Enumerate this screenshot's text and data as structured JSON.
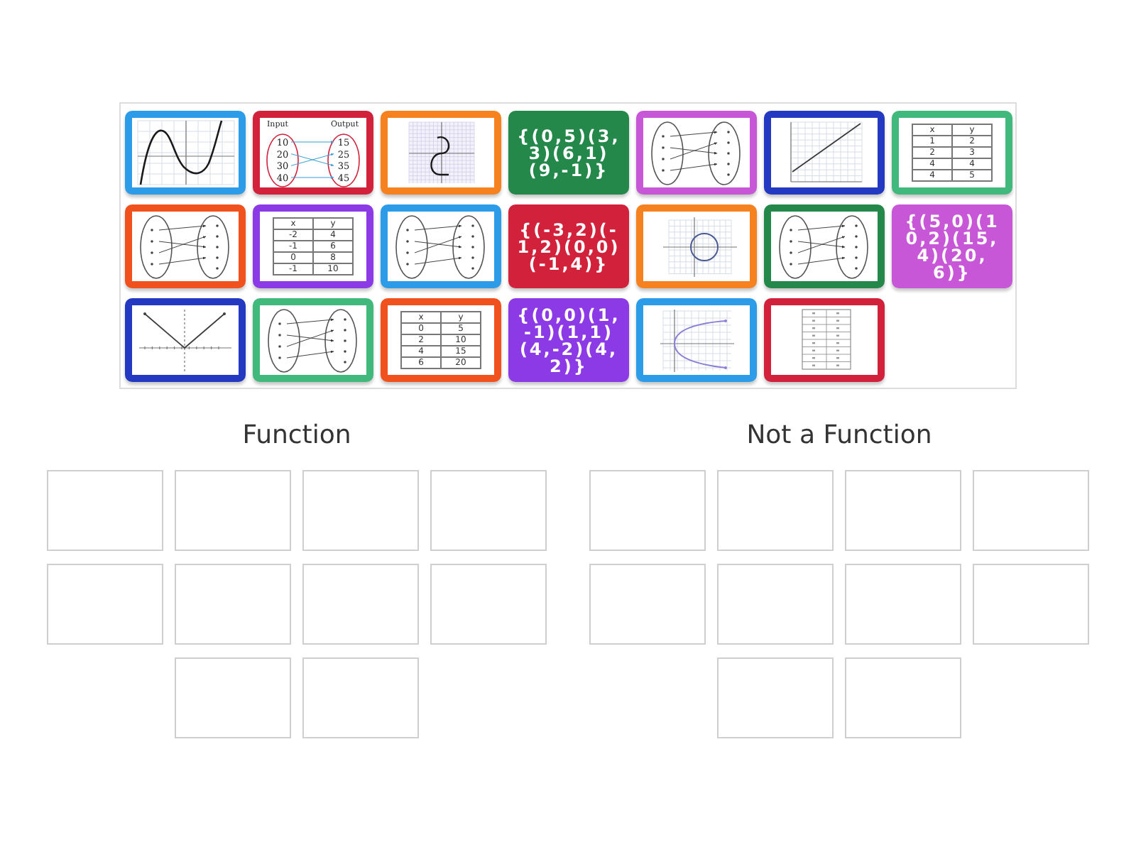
{
  "tiles": [
    {
      "kind": "cubic",
      "color": "#2c9be8"
    },
    {
      "kind": "mapping",
      "color": "#d2213a",
      "input_label": "Input",
      "output_label": "Output",
      "inputs": [
        "10",
        "20",
        "30",
        "40"
      ],
      "outputs": [
        "15",
        "25",
        "35",
        "45"
      ]
    },
    {
      "kind": "scurve",
      "color": "#f5821f"
    },
    {
      "kind": "pairs",
      "color": "#23884a",
      "text": "{(0,5)(3,3)(6,1)(9,-1)}"
    },
    {
      "kind": "mapping",
      "color": "#c757d6"
    },
    {
      "kind": "line",
      "color": "#2439c2"
    },
    {
      "kind": "table",
      "color": "#41b97d",
      "rows": [
        [
          "x",
          "y"
        ],
        [
          "1",
          "2"
        ],
        [
          "2",
          "3"
        ],
        [
          "4",
          "4"
        ],
        [
          "4",
          "5"
        ]
      ]
    },
    {
      "kind": "mapping",
      "color": "#f0511d"
    },
    {
      "kind": "table",
      "color": "#8b3ae6",
      "rows": [
        [
          "x",
          "y"
        ],
        [
          "-2",
          "4"
        ],
        [
          "-1",
          "6"
        ],
        [
          "0",
          "8"
        ],
        [
          "-1",
          "10"
        ]
      ]
    },
    {
      "kind": "mapping",
      "color": "#2c9be8"
    },
    {
      "kind": "pairs",
      "color": "#d2213a",
      "text": "{(-3,2)(-1,2)(0,0)(-1,4)}"
    },
    {
      "kind": "circle",
      "color": "#f5821f"
    },
    {
      "kind": "mapping",
      "color": "#23884a"
    },
    {
      "kind": "pairs",
      "color": "#c757d6",
      "text": "{(5,0)(10,2)(15,4)(20,6)}"
    },
    {
      "kind": "vshape",
      "color": "#2439c2"
    },
    {
      "kind": "mapping",
      "color": "#41b97d"
    },
    {
      "kind": "table",
      "color": "#f0511d",
      "rows": [
        [
          "x",
          "y"
        ],
        [
          "0",
          "5"
        ],
        [
          "2",
          "10"
        ],
        [
          "4",
          "15"
        ],
        [
          "6",
          "20"
        ]
      ]
    },
    {
      "kind": "pairs",
      "color": "#8b3ae6",
      "text": "{(0,0)(1,-1)(1,1)(4,-2)(4,2)}"
    },
    {
      "kind": "parabola",
      "color": "#2c9be8"
    },
    {
      "kind": "table",
      "color": "#d2213a"
    }
  ],
  "groups": [
    {
      "title": "Function"
    },
    {
      "title": "Not a Function"
    }
  ]
}
